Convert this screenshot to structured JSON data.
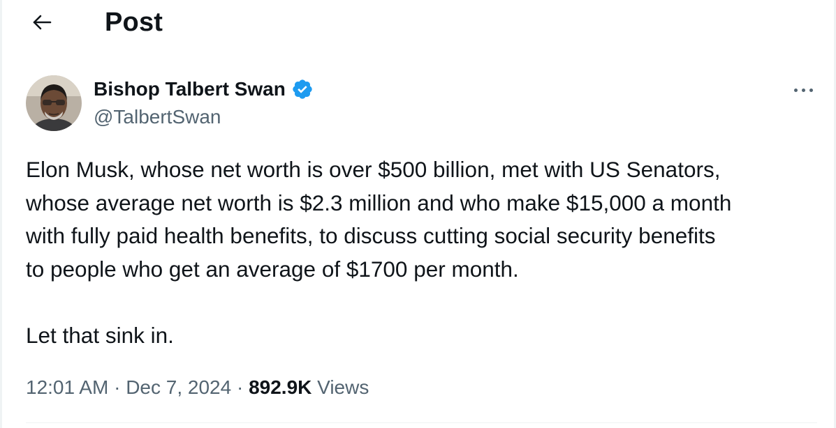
{
  "header": {
    "title": "Post",
    "back_icon": "arrow-left-icon"
  },
  "author": {
    "name": "Bishop Talbert Swan",
    "handle": "@TalbertSwan",
    "verified": true,
    "verified_color": "#1d9bf0",
    "avatar_icon": "profile-photo"
  },
  "tweet": {
    "lines": [
      "Elon Musk, whose net worth is over $500 billion, met with US Senators,",
      "whose average net worth is $2.3 million and who make $15,000 a month",
      "with fully paid health benefits, to discuss cutting social security benefits",
      "to people who get an average of $1700 per month."
    ],
    "closing": "Let that sink in."
  },
  "meta": {
    "time": "12:01 AM",
    "sep1": " · ",
    "date": "Dec 7, 2024",
    "sep2": " · ",
    "views_count": "892.9K",
    "views_label": " Views"
  },
  "more_icon": "more-horizontal-icon"
}
